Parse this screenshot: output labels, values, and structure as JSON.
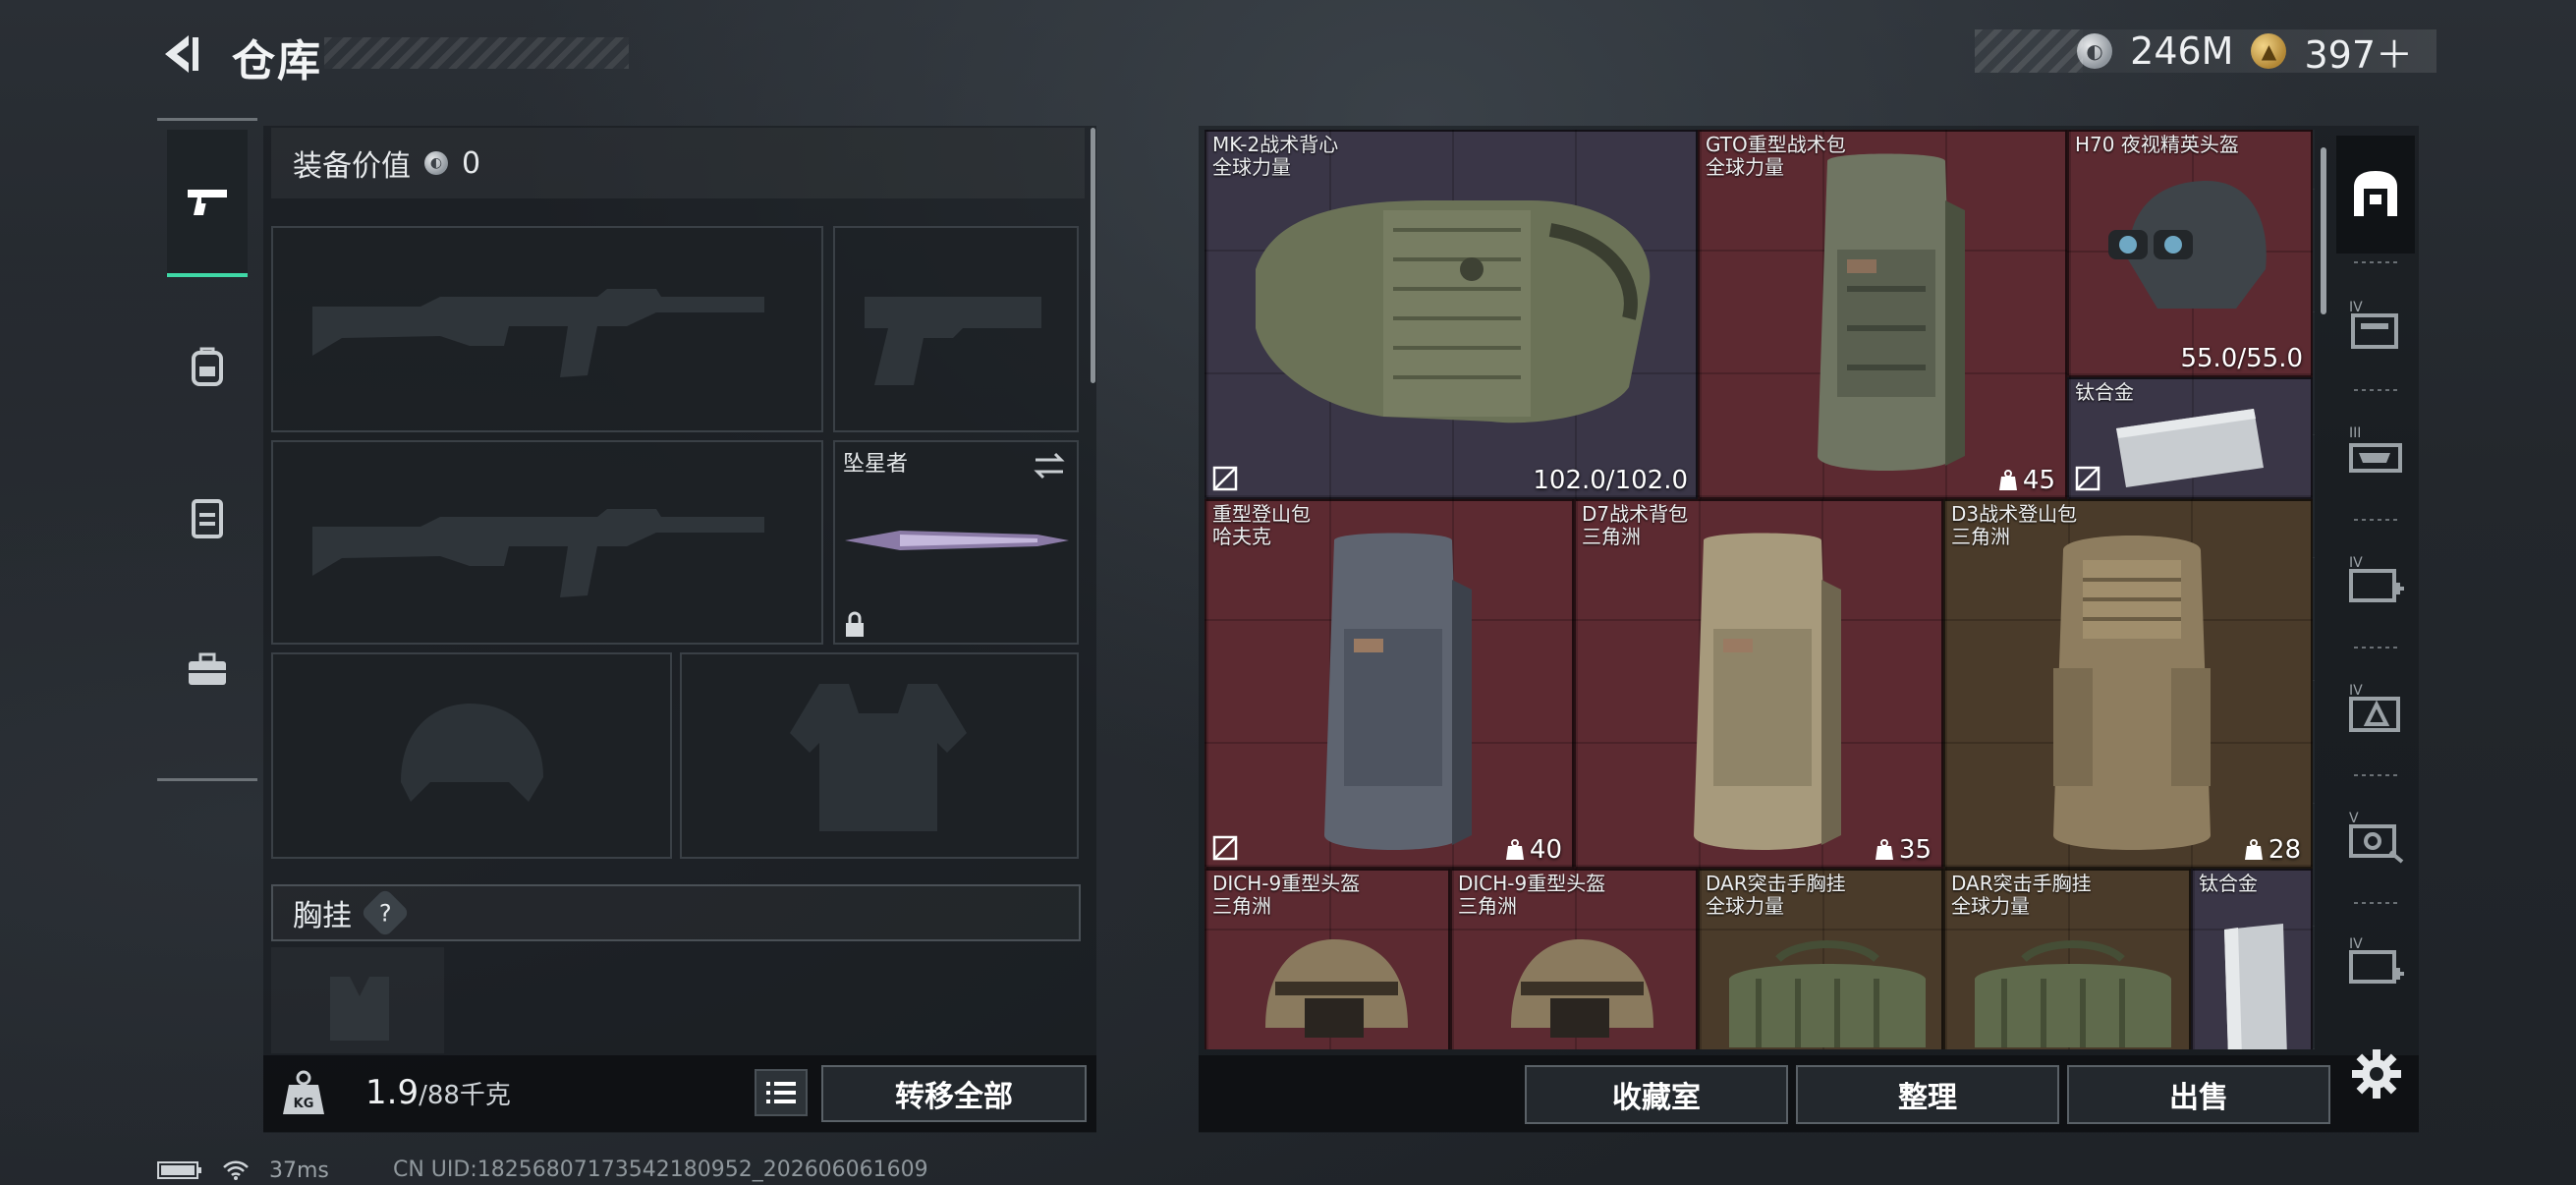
{
  "header": {
    "title": "仓库",
    "currencies": [
      {
        "icon": "silver-coin-icon",
        "value": "246M"
      },
      {
        "icon": "gold-coin-icon",
        "value": "397＋"
      }
    ]
  },
  "left_rail": {
    "tabs": [
      {
        "icon": "pistol-icon",
        "active": true
      },
      {
        "icon": "backpack-icon",
        "active": false
      },
      {
        "icon": "vest-icon",
        "active": false
      },
      {
        "icon": "toolbox-icon",
        "active": false
      }
    ]
  },
  "equipment": {
    "value_label": "装备价值",
    "value": "0",
    "melee_name": "坠星者",
    "chest_label": "胸挂",
    "help": "?",
    "weight_value": "1.9",
    "weight_capacity": "/88千克",
    "transfer_all": "转移全部"
  },
  "storage": {
    "items": [
      {
        "name": "MK-2战术背心",
        "sub": "全球力量",
        "stat": "102.0/102.0"
      },
      {
        "name": "GTO重型战术包",
        "sub": "全球力量",
        "weight": "45"
      },
      {
        "name": "H70 夜视精英头盔",
        "sub": "",
        "stat": "55.0/55.0"
      },
      {
        "name": "钛合金",
        "sub": ""
      },
      {
        "name": "重型登山包",
        "sub": "哈夫克",
        "weight": "40"
      },
      {
        "name": "D7战术背包",
        "sub": "三角洲",
        "weight": "35"
      },
      {
        "name": "D3战术登山包",
        "sub": "三角洲",
        "weight": "28"
      },
      {
        "name": "DICH-9重型头盔",
        "sub": "三角洲"
      },
      {
        "name": "DICH-9重型头盔",
        "sub": "三角洲"
      },
      {
        "name": "DAR突击手胸挂",
        "sub": "全球力量"
      },
      {
        "name": "DAR突击手胸挂",
        "sub": "全球力量"
      },
      {
        "name": "钛合金",
        "sub": ""
      }
    ],
    "actions": {
      "collection": "收藏室",
      "organize": "整理",
      "sell": "出售"
    }
  },
  "filters": [
    {
      "icon": "all-items-icon",
      "label": ""
    },
    {
      "icon": "ammo-box-icon",
      "label": "IV"
    },
    {
      "icon": "weapon-case-icon",
      "label": "III"
    },
    {
      "icon": "medical-case-icon",
      "label": "IV"
    },
    {
      "icon": "key-case-icon",
      "label": "IV"
    },
    {
      "icon": "vault-case-icon",
      "label": "V"
    },
    {
      "icon": "add-case-icon",
      "label": "IV"
    }
  ],
  "status": {
    "ping": "37ms",
    "uid": "CN UID:18256807173542180952_202606061609"
  },
  "colors": {
    "accent": "#3fd8a6",
    "rarity_red": "#5c2a31",
    "rarity_purple": "#3a3647",
    "rarity_gold": "#4a3b2a"
  }
}
